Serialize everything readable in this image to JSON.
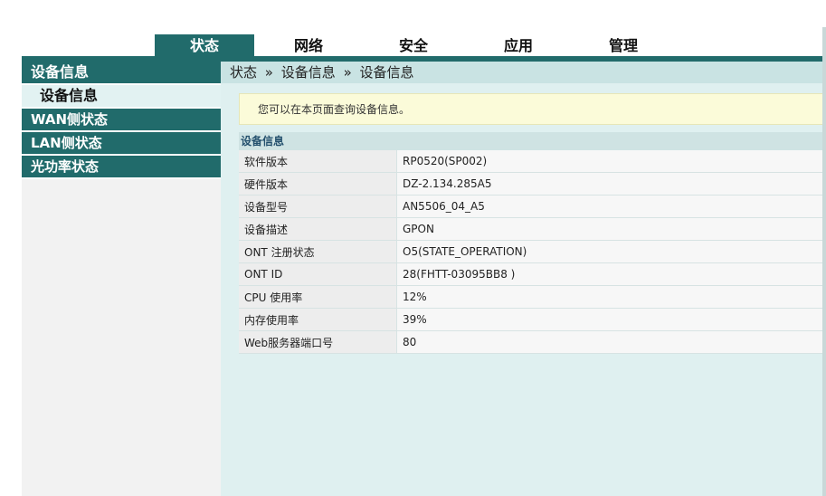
{
  "nav": {
    "tabs": [
      {
        "label": "状态",
        "active": true
      },
      {
        "label": "网络",
        "active": false
      },
      {
        "label": "安全",
        "active": false
      },
      {
        "label": "应用",
        "active": false
      },
      {
        "label": "管理",
        "active": false
      }
    ]
  },
  "sidebar": {
    "section": "设备信息",
    "active_sub": "设备信息",
    "items": [
      "WAN侧状态",
      "LAN侧状态",
      "光功率状态"
    ]
  },
  "breadcrumb": [
    "状态",
    "»",
    "设备信息",
    "»",
    "设备信息"
  ],
  "notice": "您可以在本页面查询设备信息。",
  "info": {
    "title": "设备信息",
    "rows": [
      {
        "k": "软件版本",
        "v": "RP0520(SP002)"
      },
      {
        "k": "硬件版本",
        "v": "DZ-2.134.285A5"
      },
      {
        "k": "设备型号",
        "v": "AN5506_04_A5"
      },
      {
        "k": "设备描述",
        "v": "GPON"
      },
      {
        "k": "ONT 注册状态",
        "v": "O5(STATE_OPERATION)"
      },
      {
        "k": "ONT ID",
        "v": "28(FHTT-03095BB8 )"
      },
      {
        "k": "CPU 使用率",
        "v": "12%"
      },
      {
        "k": "内存使用率",
        "v": "39%"
      },
      {
        "k": "Web服务器端口号",
        "v": "80"
      }
    ]
  },
  "colors": {
    "accent": "#216b6b",
    "content_bg": "#dff0f0",
    "notice_bg": "#fbfbd9"
  }
}
